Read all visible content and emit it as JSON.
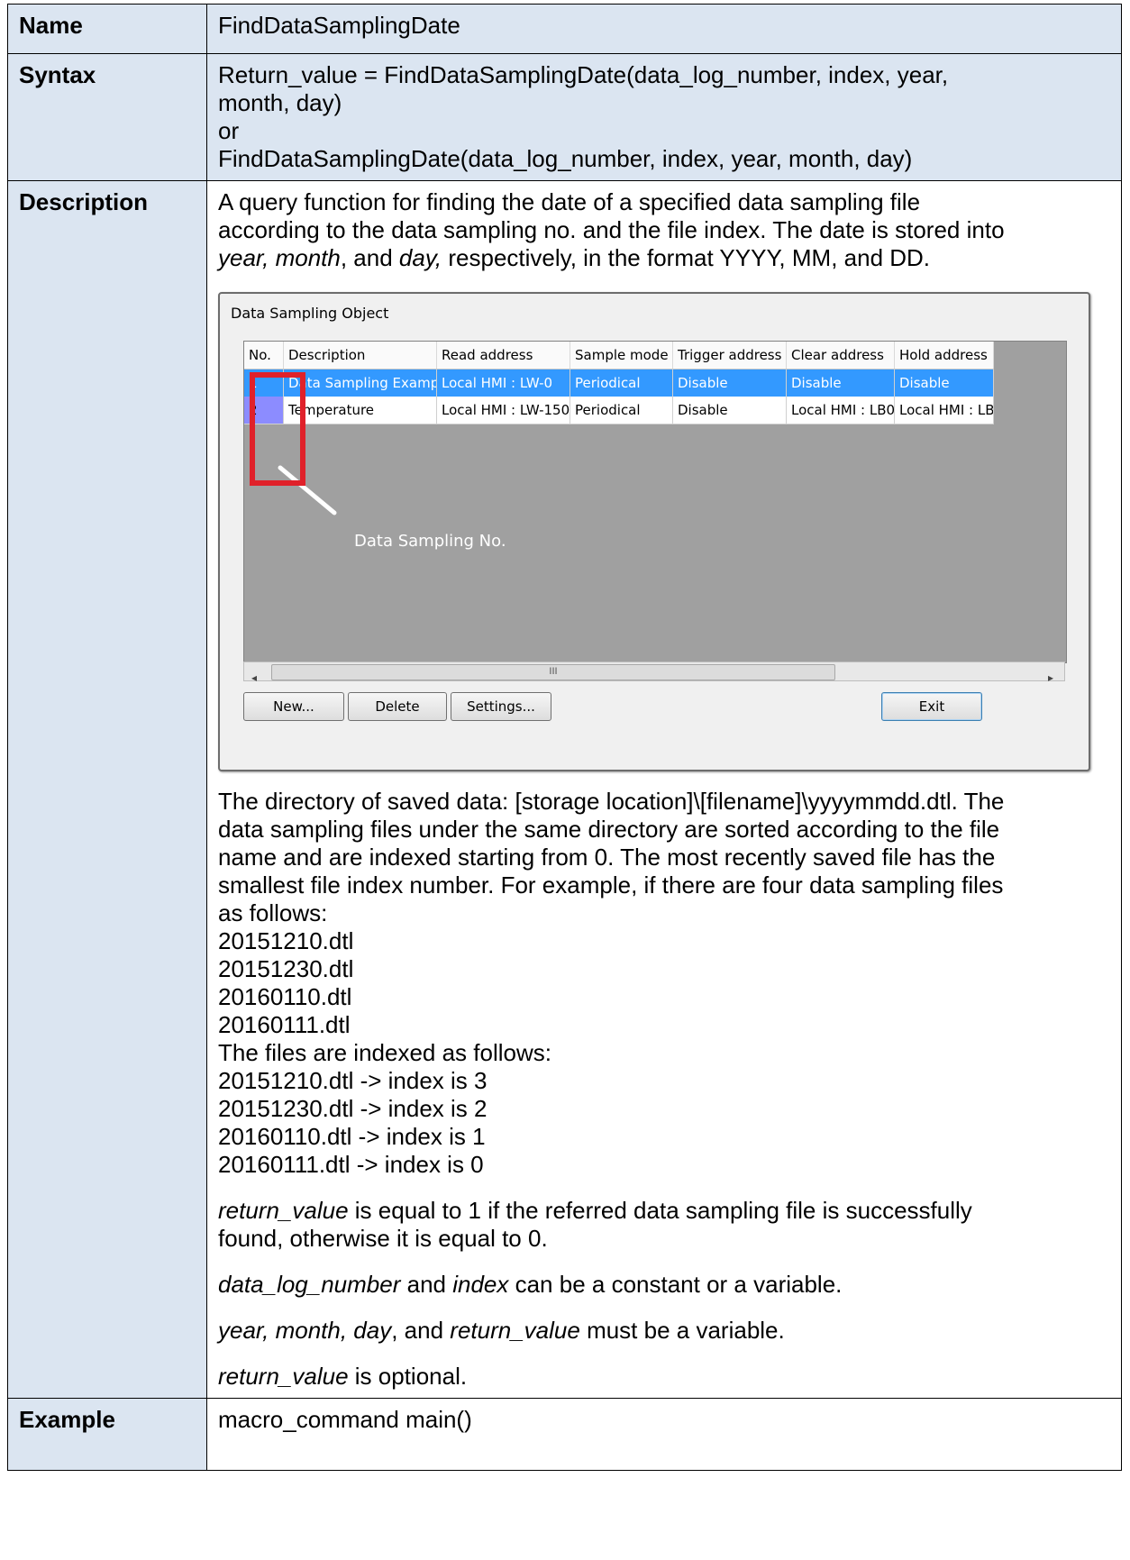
{
  "rows": {
    "name": {
      "label": "Name",
      "value": "FindDataSamplingDate"
    },
    "syntax": {
      "label": "Syntax",
      "lines": [
        "Return_value = FindDataSamplingDate(data_log_number, index, year,",
        "month, day)",
        "or",
        "FindDataSamplingDate(data_log_number, index, year, month, day)"
      ]
    },
    "description": {
      "label": "Description",
      "intro": {
        "line1": "A query function for finding the date of a specified data sampling file",
        "line2": "according to the data sampling no. and the file index. The date is stored into",
        "l3_i1": "year, month",
        "l3_t1": ", and ",
        "l3_i2": "day,",
        "l3_t2": " respectively, in the format YYYY, MM, and DD."
      },
      "dialog": {
        "title": "Data Sampling Object",
        "columns": [
          "No.",
          "Description",
          "Read address",
          "Sample mode",
          "Trigger address",
          "Clear address",
          "Hold address"
        ],
        "rows": [
          [
            "1",
            "Data Sampling Example",
            "Local HMI : LW-0",
            "Periodical",
            "Disable",
            "Disable",
            "Disable"
          ],
          [
            "2",
            "Temperature",
            "Local HMI : LW-150",
            "Periodical",
            "Disable",
            "Local HMI : LB0",
            "Local HMI : LB"
          ]
        ],
        "callout": "Data Sampling No.",
        "scroll_left": "◂",
        "scroll_grip": "III",
        "scroll_right": "▸",
        "buttons": {
          "new": "New...",
          "delete": "Delete",
          "settings": "Settings...",
          "exit": "Exit"
        }
      },
      "body_lines": [
        "The directory of saved data: [storage location]\\[filename]\\yyyymmdd.dtl. The",
        "data sampling files under the same directory are sorted according to the file",
        "name and are indexed starting from 0. The most recently saved file has the",
        "smallest file index number. For example, if there are four data sampling files",
        "as follows:",
        "20151210.dtl",
        "20151230.dtl",
        "20160110.dtl",
        "20160111.dtl",
        "The files are indexed as follows:",
        "20151210.dtl -> index is 3",
        "20151230.dtl -> index is 2",
        "20160110.dtl -> index is 1",
        "20160111.dtl -> index is 0"
      ],
      "notes": {
        "n1_i": "return_value",
        "n1_t": " is equal to 1 if the referred data sampling file is successfully",
        "n1_line2": "found, otherwise it is equal to 0.",
        "n2_i1": "data_log_number",
        "n2_t1": " and ",
        "n2_i2": "index",
        "n2_t2": " can be a constant or a variable.",
        "n3_i1": "year, month, day",
        "n3_t1": ", and ",
        "n3_i2": "return_value",
        "n3_t2": " must be a variable.",
        "n4_i": "return_value",
        "n4_t": " is optional."
      }
    },
    "example": {
      "label": "Example",
      "value": "macro_command main()"
    }
  }
}
